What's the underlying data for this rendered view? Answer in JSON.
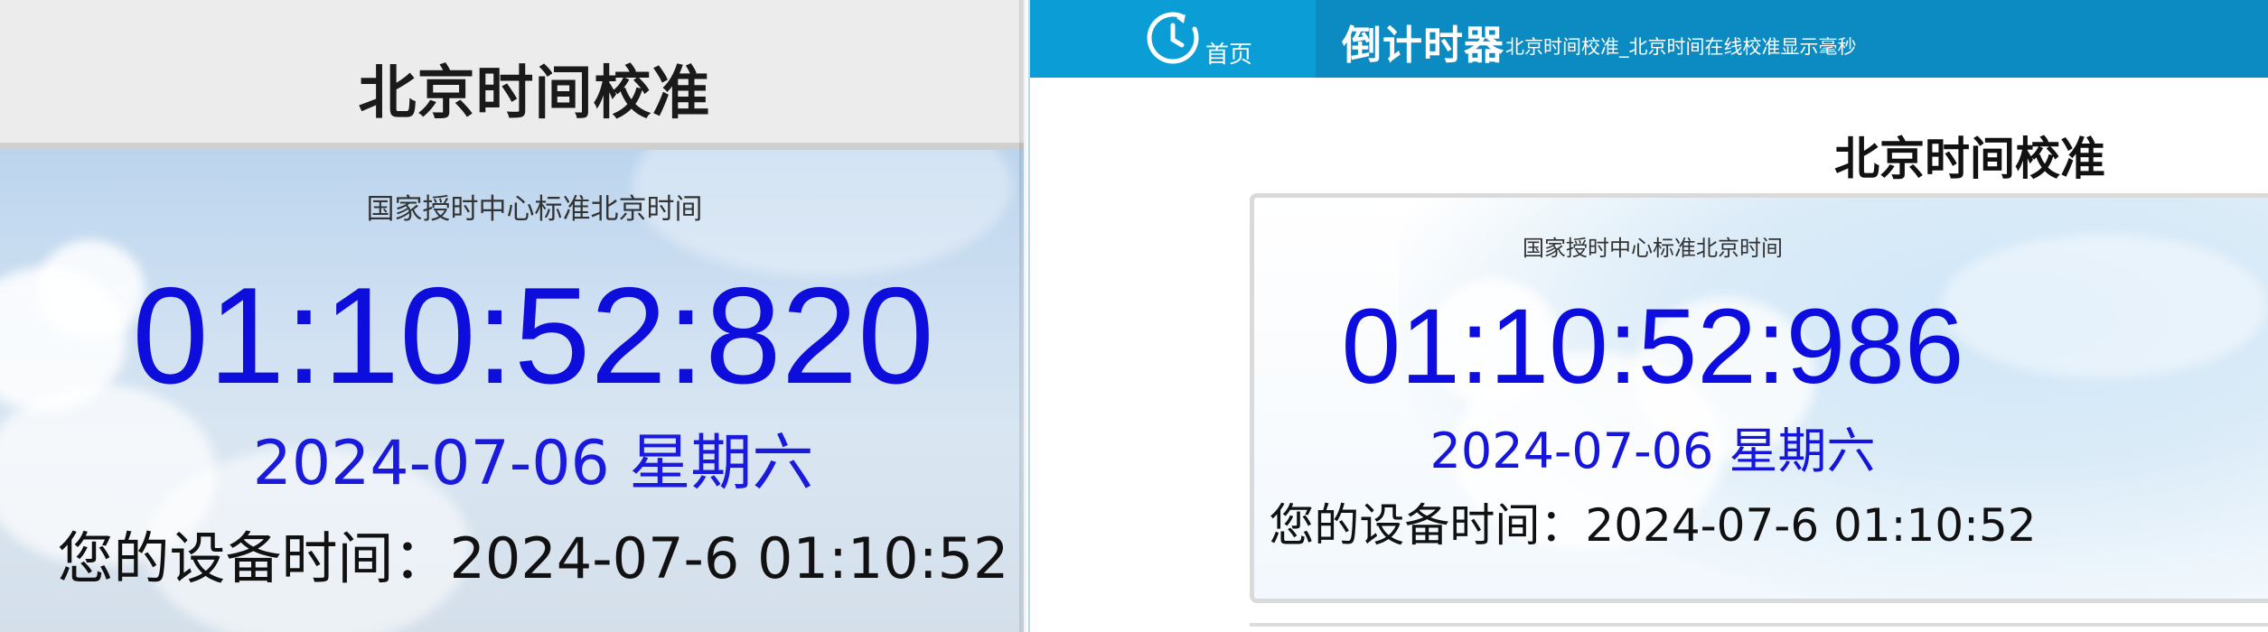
{
  "left_window": {
    "title": "北京时间校准",
    "subtitle": "国家授时中心标准北京时间",
    "time": "01:10:52:820",
    "date": "2024-07-06 星期六",
    "device_time": "您的设备时间：2024-07-6 01:10:52"
  },
  "navbar": {
    "home_label": "首页",
    "brand": "倒计时器",
    "tagline": "北京时间校准_北京时间在线校准显示毫秒",
    "icon": "clock-icon"
  },
  "page": {
    "title": "北京时间校准",
    "subtitle": "国家授时中心标准北京时间",
    "time": "01:10:52:986",
    "date": "2024-07-06 星期六",
    "device_time": "您的设备时间：2024-07-6 01:10:52"
  },
  "colors": {
    "time_blue": "#0d0ddf",
    "nav_blue": "#0b8bc2",
    "nav_home_blue": "#0a9dd6"
  }
}
